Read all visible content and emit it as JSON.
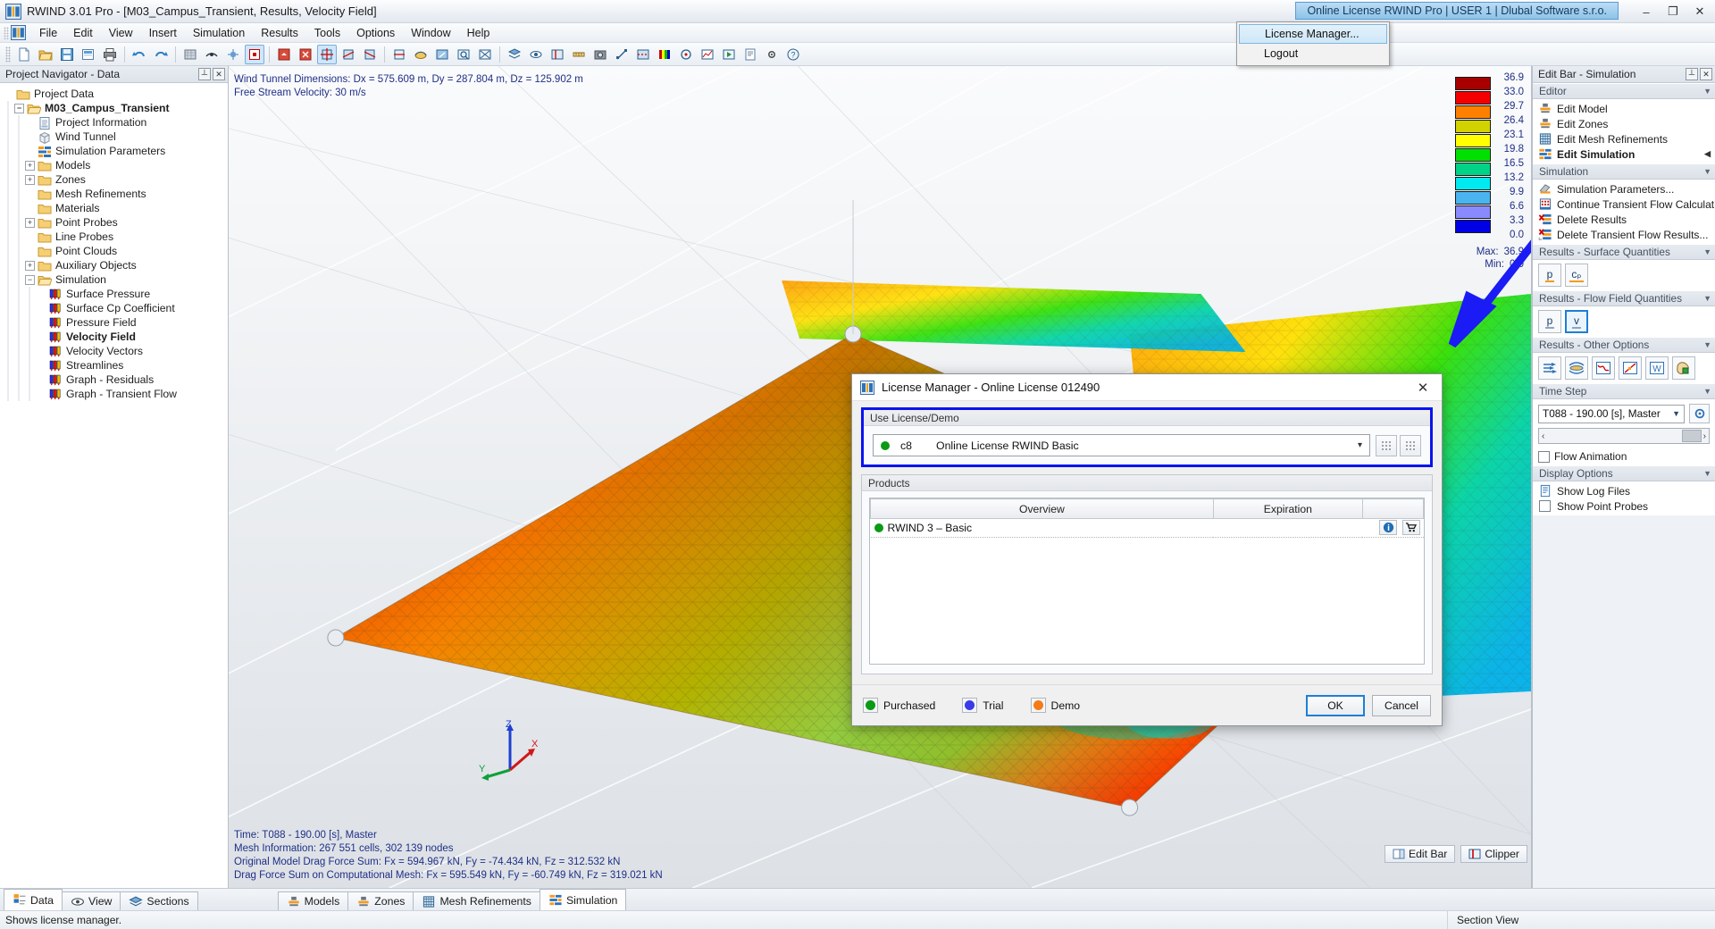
{
  "window": {
    "title": "RWIND 3.01 Pro - [M03_Campus_Transient, Results, Velocity Field]",
    "app_icon": "rwind-icon",
    "minimize": "–",
    "restore": "❐",
    "close": "✕"
  },
  "license_pill": {
    "label": "Online License RWIND Pro | USER 1 | Dlubal Software s.r.o."
  },
  "license_menu": {
    "items": [
      {
        "label": "License Manager...",
        "selected": true
      },
      {
        "label": "Logout",
        "selected": false
      }
    ]
  },
  "menubar": {
    "items": [
      "File",
      "Edit",
      "View",
      "Insert",
      "Simulation",
      "Results",
      "Tools",
      "Options",
      "Window",
      "Help"
    ]
  },
  "toolbar": {
    "groups": [
      [
        "new-file-icon",
        "open-folder-icon",
        "save-icon",
        "save-as-icon",
        "print-icon"
      ],
      [
        "undo-icon",
        "redo-icon"
      ],
      [
        "render-surface-icon",
        "render-wire-icon",
        "grid-snap-icon",
        "selection-box-icon"
      ],
      [
        "view-solid-icon",
        "view-xray-icon",
        "rotate-view-icon",
        "rotate-view-2-icon",
        "rotate-view-3-icon"
      ],
      [
        "pan-icon",
        "orbit-icon",
        "zoom-previous-icon",
        "zoom-window-icon",
        "zoom-extents-icon"
      ],
      [
        "layer-icon",
        "visibility-icon",
        "clip-icon",
        "measure-icon",
        "snapshot-icon",
        "scale-icon",
        "section-icon",
        "color-icon",
        "probe-icon",
        "graph-icon",
        "anim-icon",
        "report-icon",
        "settings-icon",
        "help-tool-icon"
      ]
    ]
  },
  "navigator": {
    "caption": "Project Navigator - Data",
    "pin_icon": "pin-icon",
    "close_icon": "close-icon",
    "tree": [
      {
        "label": "Project Data",
        "indent": 0,
        "expander": "none",
        "icon": "folder-icon",
        "bold": false
      },
      {
        "label": "M03_Campus_Transient",
        "indent": 1,
        "expander": "minus",
        "icon": "folder-open-icon",
        "bold": true
      },
      {
        "label": "Project Information",
        "indent": 2,
        "expander": "none",
        "icon": "document-icon",
        "bold": false
      },
      {
        "label": "Wind Tunnel",
        "indent": 2,
        "expander": "none",
        "icon": "cube-icon",
        "bold": false
      },
      {
        "label": "Simulation Parameters",
        "indent": 2,
        "expander": "none",
        "icon": "params-icon",
        "bold": false
      },
      {
        "label": "Models",
        "indent": 2,
        "expander": "plus",
        "icon": "folder-icon",
        "bold": false
      },
      {
        "label": "Zones",
        "indent": 2,
        "expander": "plus",
        "icon": "folder-icon",
        "bold": false
      },
      {
        "label": "Mesh Refinements",
        "indent": 2,
        "expander": "none",
        "icon": "folder-icon",
        "bold": false
      },
      {
        "label": "Materials",
        "indent": 2,
        "expander": "none",
        "icon": "folder-icon",
        "bold": false
      },
      {
        "label": "Point Probes",
        "indent": 2,
        "expander": "plus",
        "icon": "folder-icon",
        "bold": false
      },
      {
        "label": "Line Probes",
        "indent": 2,
        "expander": "none",
        "icon": "folder-icon",
        "bold": false
      },
      {
        "label": "Point Clouds",
        "indent": 2,
        "expander": "none",
        "icon": "folder-icon",
        "bold": false
      },
      {
        "label": "Auxiliary Objects",
        "indent": 2,
        "expander": "plus",
        "icon": "folder-icon",
        "bold": false
      },
      {
        "label": "Simulation",
        "indent": 2,
        "expander": "minus",
        "icon": "folder-open-icon",
        "bold": false
      },
      {
        "label": "Surface Pressure",
        "indent": 3,
        "expander": "none",
        "icon": "colorbar-icon",
        "bold": false
      },
      {
        "label": "Surface Cp Coefficient",
        "indent": 3,
        "expander": "none",
        "icon": "colorbar-icon",
        "bold": false
      },
      {
        "label": "Pressure Field",
        "indent": 3,
        "expander": "none",
        "icon": "colorbar-icon",
        "bold": false
      },
      {
        "label": "Velocity Field",
        "indent": 3,
        "expander": "none",
        "icon": "colorbar-icon",
        "bold": true
      },
      {
        "label": "Velocity Vectors",
        "indent": 3,
        "expander": "none",
        "icon": "colorbar-icon",
        "bold": false
      },
      {
        "label": "Streamlines",
        "indent": 3,
        "expander": "none",
        "icon": "colorbar-icon",
        "bold": false
      },
      {
        "label": "Graph - Residuals",
        "indent": 3,
        "expander": "none",
        "icon": "colorbar-icon",
        "bold": false
      },
      {
        "label": "Graph - Transient Flow",
        "indent": 3,
        "expander": "none",
        "icon": "colorbar-icon",
        "bold": false
      }
    ]
  },
  "viewport": {
    "info_top": "Wind Tunnel Dimensions: Dx = 575.609 m, Dy = 287.804 m, Dz = 125.902 m\nFree Stream Velocity: 30 m/s",
    "info_bottom": "Time: T088 - 190.00 [s], Master\nMesh Information: 267 551 cells, 302 139 nodes\nOriginal Model Drag Force Sum: Fx = 594.967 kN, Fy = -74.434 kN, Fz = 312.532 kN\nDrag Force Sum on Computational Mesh: Fx = 595.549 kN, Fy = -60.749 kN, Fz = 319.021 kN",
    "axis_x": "X",
    "axis_y": "Y",
    "axis_z": "Z"
  },
  "legend": {
    "colors": [
      "#a80000",
      "#f50000",
      "#ff8000",
      "#d2d200",
      "#ffff00",
      "#00e000",
      "#00d287",
      "#00eaf0",
      "#4ab4f0",
      "#8a8aff",
      "#0000e6"
    ],
    "ticks": [
      "36.9",
      "33.0",
      "29.7",
      "26.4",
      "23.1",
      "19.8",
      "16.5",
      "13.2",
      "9.9",
      "6.6",
      "3.3",
      "0.0"
    ],
    "max_label": "Max:",
    "max_value": "36.9",
    "min_label": "Min:",
    "min_value": "0.0"
  },
  "editbar": {
    "caption": "Edit Bar - Simulation",
    "groups": [
      {
        "title": "Editor",
        "type": "list",
        "items": [
          {
            "label": "Edit Model",
            "icon": "edit-model-icon",
            "bold": false,
            "arrow": false
          },
          {
            "label": "Edit Zones",
            "icon": "edit-zones-icon",
            "bold": false,
            "arrow": false
          },
          {
            "label": "Edit Mesh Refinements",
            "icon": "mesh-grid-icon",
            "bold": false,
            "arrow": false
          },
          {
            "label": "Edit Simulation",
            "icon": "params-icon",
            "bold": true,
            "arrow": true
          }
        ]
      },
      {
        "title": "Simulation",
        "type": "list",
        "items": [
          {
            "label": "Simulation Parameters...",
            "icon": "sim-params-icon",
            "bold": false,
            "arrow": false
          },
          {
            "label": "Continue Transient Flow Calculat...",
            "icon": "continue-calc-icon",
            "bold": false,
            "arrow": false
          },
          {
            "label": "Delete Results",
            "icon": "delete-results-icon",
            "bold": false,
            "arrow": false
          },
          {
            "label": "Delete Transient Flow Results...",
            "icon": "delete-transient-icon",
            "bold": false,
            "arrow": false
          }
        ]
      },
      {
        "title": "Results - Surface Quantities",
        "type": "buttons",
        "buttons": [
          {
            "label": "p",
            "name": "surface-pressure-button",
            "active": false
          },
          {
            "label": "cₚ",
            "name": "surface-cp-button",
            "active": false
          }
        ]
      },
      {
        "title": "Results - Flow Field Quantities",
        "type": "buttons",
        "buttons": [
          {
            "label": "p",
            "name": "field-pressure-button",
            "active": false
          },
          {
            "label": "v",
            "name": "field-velocity-button",
            "active": true
          }
        ]
      },
      {
        "title": "Results - Other Options",
        "type": "icon-buttons",
        "buttons": [
          {
            "name": "velocity-vectors-button",
            "icon": "arrows-icon"
          },
          {
            "name": "streamlines-button",
            "icon": "streamlines-icon"
          },
          {
            "name": "residual-graph-button",
            "icon": "residual-graph-icon"
          },
          {
            "name": "transient-graph-button",
            "icon": "transient-graph-icon"
          },
          {
            "name": "wind-profile-button",
            "icon": "w-icon"
          },
          {
            "name": "colorscale-button",
            "icon": "palette-icon"
          }
        ]
      }
    ],
    "time_step": {
      "title": "Time Step",
      "value": "T088 - 190.00 [s], Master",
      "settings_icon": "gear-icon",
      "prev": "‹",
      "next": "›",
      "flow_animation_label": "Flow Animation",
      "flow_animation_checked": false
    },
    "display_options": {
      "title": "Display Options",
      "items": [
        {
          "label": "Show Log Files",
          "icon": "log-file-icon"
        },
        {
          "label": "Show Point Probes",
          "icon": "point-probe-icon"
        }
      ]
    }
  },
  "dialog": {
    "title": "License Manager - Online License 012490",
    "icon": "rwind-icon",
    "close": "✕",
    "group_license": {
      "caption": "Use License/Demo",
      "status_color": "#0a9a16",
      "code": "c8",
      "name": "Online License RWIND Basic",
      "dropdown_arrow": "▾",
      "side_button_1": "grid-button-1",
      "side_button_2": "grid-button-2"
    },
    "group_products": {
      "caption": "Products",
      "columns": [
        "Overview",
        "Expiration",
        ""
      ],
      "rows": [
        {
          "status_color": "#0a9a16",
          "overview": "RWIND 3 – Basic",
          "expiration": "",
          "info_icon": "info-icon",
          "cart_icon": "cart-icon"
        }
      ]
    },
    "legend": [
      {
        "label": "Purchased",
        "color": "#0a9a16"
      },
      {
        "label": "Trial",
        "color": "#3a3ae8"
      },
      {
        "label": "Demo",
        "color": "#f57b16"
      }
    ],
    "buttons": [
      {
        "label": "OK",
        "name": "ok-button",
        "primary": true
      },
      {
        "label": "Cancel",
        "name": "cancel-button",
        "primary": false
      }
    ]
  },
  "bottom": {
    "left_tabs": [
      {
        "label": "Data",
        "icon": "data-icon",
        "selected": true
      },
      {
        "label": "View",
        "icon": "eye-icon",
        "selected": false
      },
      {
        "label": "Sections",
        "icon": "sections-icon",
        "selected": false
      }
    ],
    "center_tabs": [
      {
        "label": "Models",
        "icon": "edit-model-icon",
        "selected": false
      },
      {
        "label": "Zones",
        "icon": "edit-zones-icon",
        "selected": false
      },
      {
        "label": "Mesh Refinements",
        "icon": "mesh-grid-icon",
        "selected": false
      },
      {
        "label": "Simulation",
        "icon": "params-icon",
        "selected": true
      }
    ],
    "float_buttons": [
      {
        "label": "Edit Bar",
        "icon": "editbar-icon"
      },
      {
        "label": "Clipper",
        "icon": "clipper-icon"
      }
    ],
    "status_text": "Shows license manager.",
    "status_right": "Section View"
  }
}
